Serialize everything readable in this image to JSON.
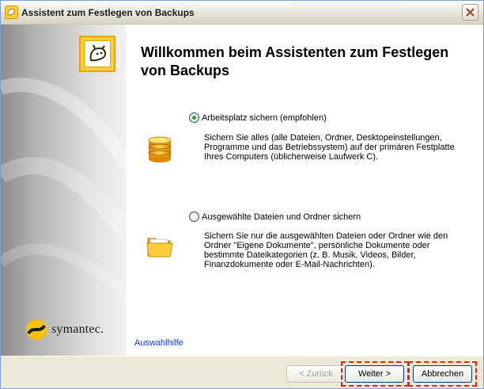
{
  "window": {
    "title": "Assistent zum Festlegen von Backups",
    "close_icon": "close-icon"
  },
  "header": {
    "title": "Willkommen beim Assistenten zum Festlegen von Backups"
  },
  "options": [
    {
      "label": "Arbeitsplatz sichern (empfohlen)",
      "selected": true,
      "description": "Sichern Sie alles (alle Dateien, Ordner, Desktopeinstellungen, Programme und das Betriebssystem) auf der primären Festplatte Ihres Computers (üblicherweise Laufwerk C).",
      "icon": "database-icon"
    },
    {
      "label": "Ausgewählte Dateien und Ordner sichern",
      "selected": false,
      "description": "Sichern Sie nur die ausgewählten Dateien oder Ordner wie den Ordner \"Eigene Dokumente\", persönliche Dokumente oder bestimmte Dateikategorien (z. B. Musik, Videos, Bilder, Finanzdokumente oder E-Mail-Nachrichten).",
      "icon": "folder-icon"
    }
  ],
  "sidebar": {
    "brand": "symantec."
  },
  "help_link": "Auswahlhilfe",
  "buttons": {
    "back": "< Zurück",
    "next": "Weiter >",
    "cancel": "Abbrechen",
    "back_enabled": false
  },
  "colors": {
    "accent_yellow": "#ffcd3f",
    "highlight": "#e3201b",
    "link": "#0c3cd6"
  }
}
